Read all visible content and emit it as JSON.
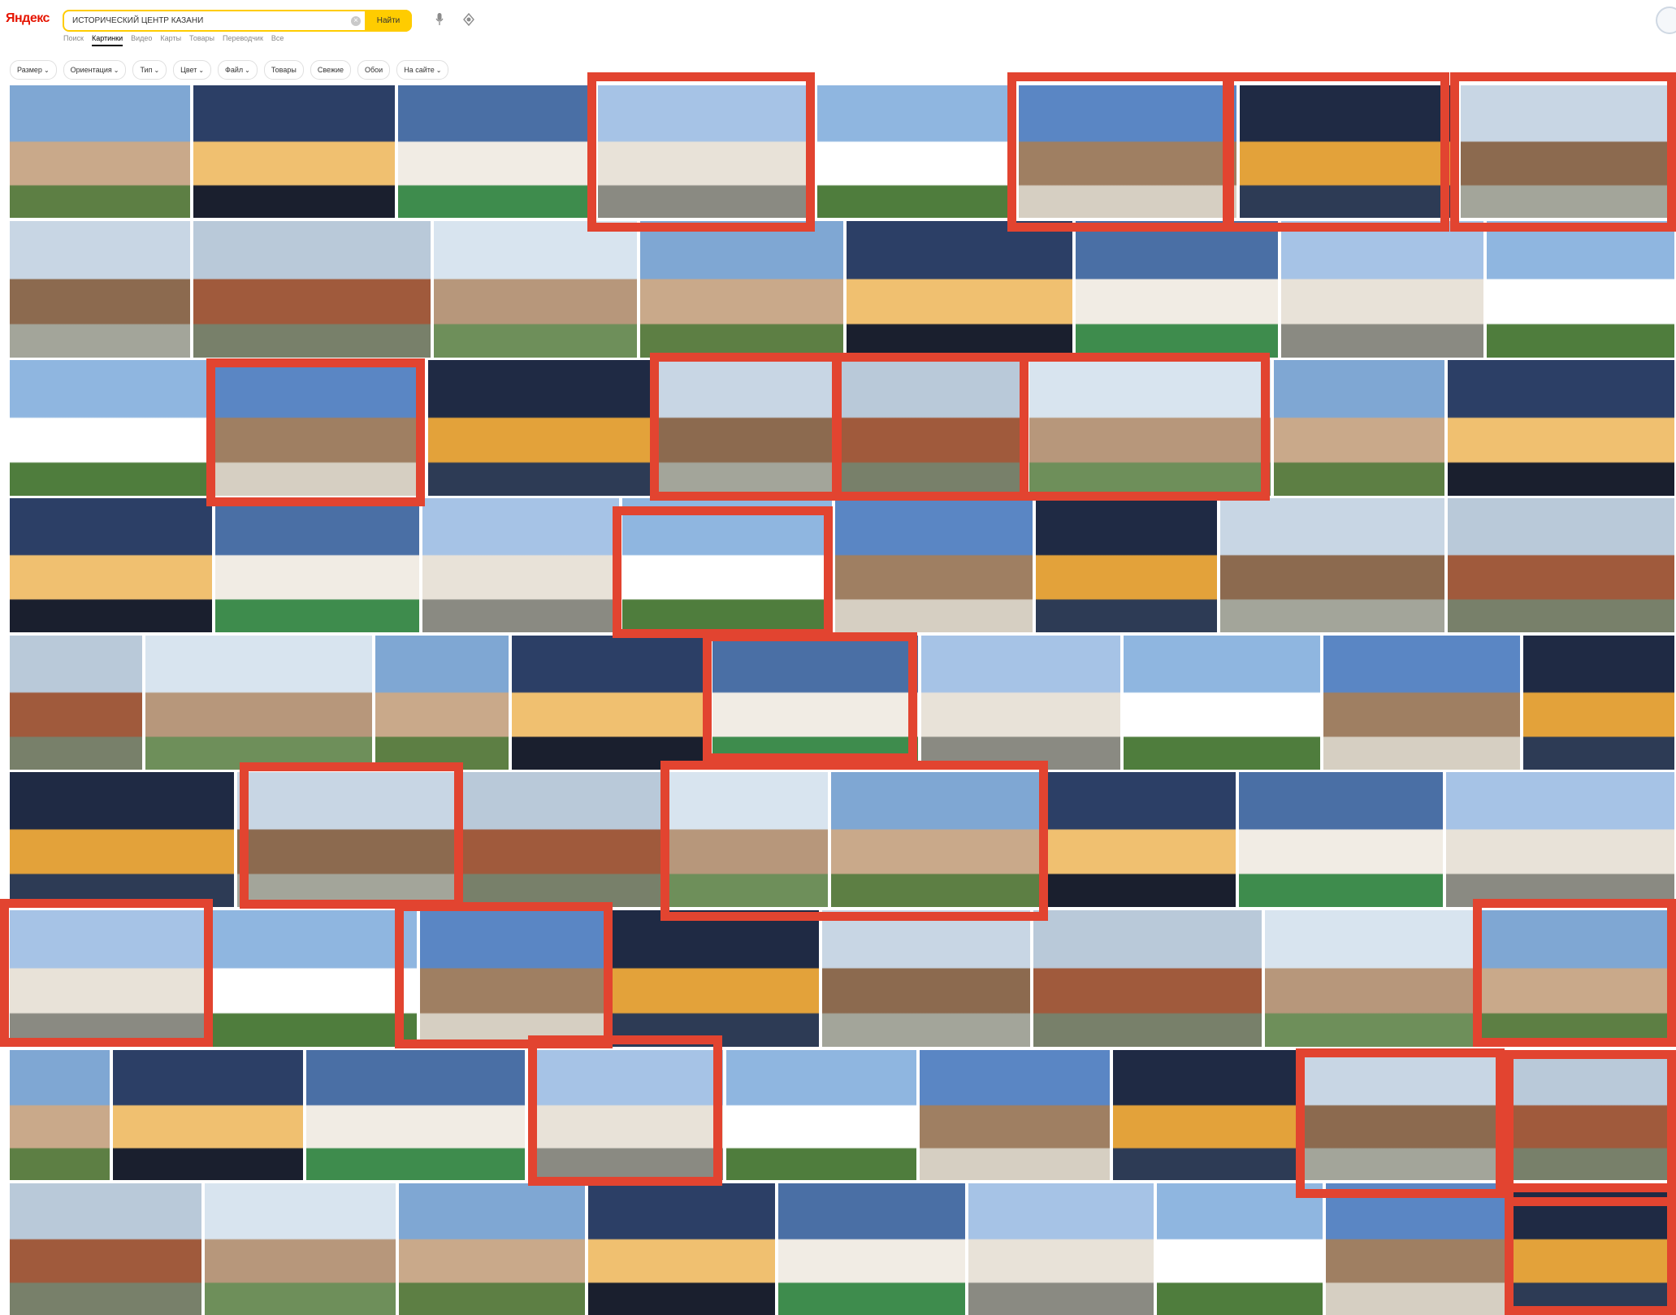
{
  "header": {
    "logo": "Яндекс",
    "search_query": "ИСТОРИЧЕСКИЙ ЦЕНТР КАЗАНИ",
    "find_label": "Найти",
    "icons": [
      "clear-icon",
      "microphone-icon",
      "camera-lens-icon",
      "avatar"
    ]
  },
  "nav_tabs": [
    "Поиск",
    "Картинки",
    "Видео",
    "Карты",
    "Товары",
    "Переводчик",
    "Все"
  ],
  "active_tab": "Картинки",
  "filters": [
    {
      "label": "Размер",
      "dropdown": true
    },
    {
      "label": "Ориентация",
      "dropdown": true
    },
    {
      "label": "Тип",
      "dropdown": true
    },
    {
      "label": "Цвет",
      "dropdown": true
    },
    {
      "label": "Файл",
      "dropdown": true
    },
    {
      "label": "Товары",
      "dropdown": false
    },
    {
      "label": "Свежие",
      "dropdown": false
    },
    {
      "label": "Обои",
      "dropdown": false
    },
    {
      "label": "На сайте",
      "dropdown": true
    }
  ],
  "colors": {
    "highlight": "#e24430",
    "search_accent": "#ffcc00",
    "logo_accent": "#e61400"
  }
}
